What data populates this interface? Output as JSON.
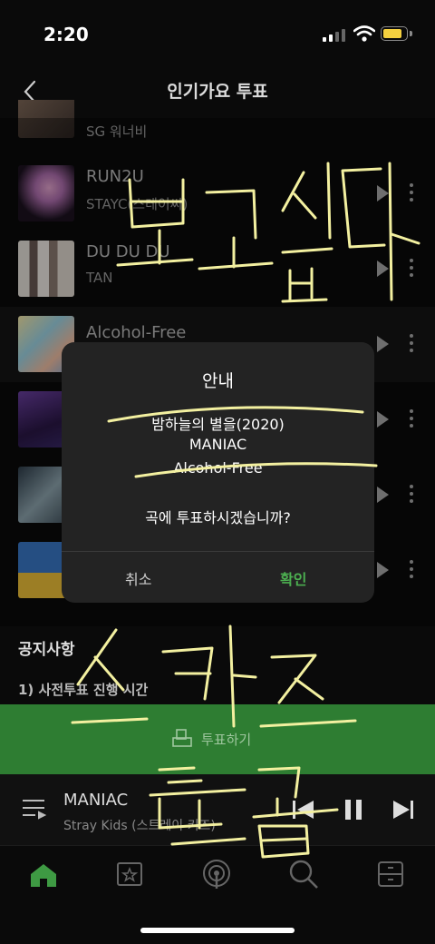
{
  "status": {
    "time": "2:20"
  },
  "header": {
    "title": "인기가요 투표"
  },
  "list": [
    {
      "song": "",
      "artist": "SG 워너비"
    },
    {
      "song": "RUN2U",
      "artist": "STAYC(스테이씨)"
    },
    {
      "song": "DU DU DU",
      "artist": "TAN"
    },
    {
      "song": "Alcohol-Free",
      "artist": ""
    },
    {
      "song": "",
      "artist": ""
    },
    {
      "song": "",
      "artist": ""
    },
    {
      "song": "",
      "artist": ""
    }
  ],
  "dialog": {
    "title": "안내",
    "lines": [
      "밤하늘의 별을(2020)",
      "MANIAC",
      "Alcohol-Free"
    ],
    "question": "곡에 투표하시겠습니까?",
    "cancel": "취소",
    "confirm": "확인"
  },
  "notice": {
    "heading": "공지사항",
    "item1": "1) 사전투표 진행 시간"
  },
  "vote_button": {
    "label": "투표하기"
  },
  "mini_player": {
    "title": "MANIAC",
    "artist": "Stray Kids (스트레이 키즈)"
  },
  "handwriting": {
    "top": "보고싶다",
    "bottom": "스키즈 특급"
  },
  "tabs": [
    "home-icon",
    "library-icon",
    "podcast-icon",
    "search-icon",
    "storage-icon"
  ],
  "colors": {
    "accent": "#4caf50",
    "vote_bar": "#2e7d32",
    "scribble": "#f3f0a0"
  }
}
